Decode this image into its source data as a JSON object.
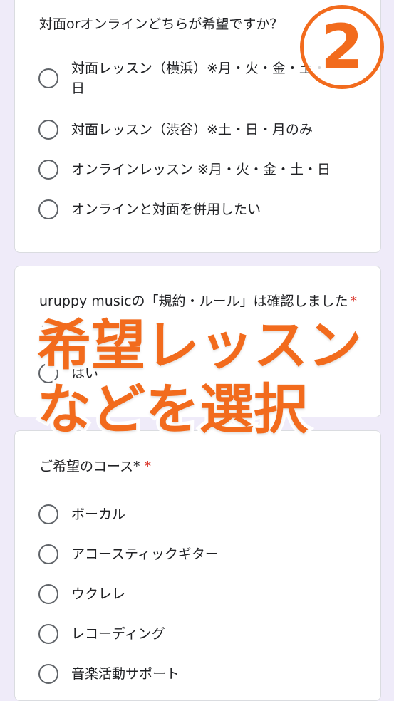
{
  "q1": {
    "title": "対面orオンラインどちらが希望ですか？",
    "options": [
      "対面レッスン（横浜）※月・火・金・土・日",
      "対面レッスン（渋谷）※土・日・月のみ",
      "オンラインレッスン ※月・火・金・土・日",
      "オンラインと対面を併用したい"
    ]
  },
  "q2": {
    "title": "uruppy musicの「規約・ルール」は確認しましたか？",
    "required_mark": "*",
    "options": [
      "はい"
    ]
  },
  "q3": {
    "title": "ご希望のコース*",
    "required_mark": "*",
    "options": [
      "ボーカル",
      "アコースティックギター",
      "ウクレレ",
      "レコーディング",
      "音楽活動サポート"
    ]
  },
  "overlay": {
    "badge": "2",
    "line1": "希望レッスン",
    "line2": "などを選択"
  },
  "colors": {
    "accent": "#f26b1d",
    "required": "#d93025",
    "background": "#efebf9"
  }
}
